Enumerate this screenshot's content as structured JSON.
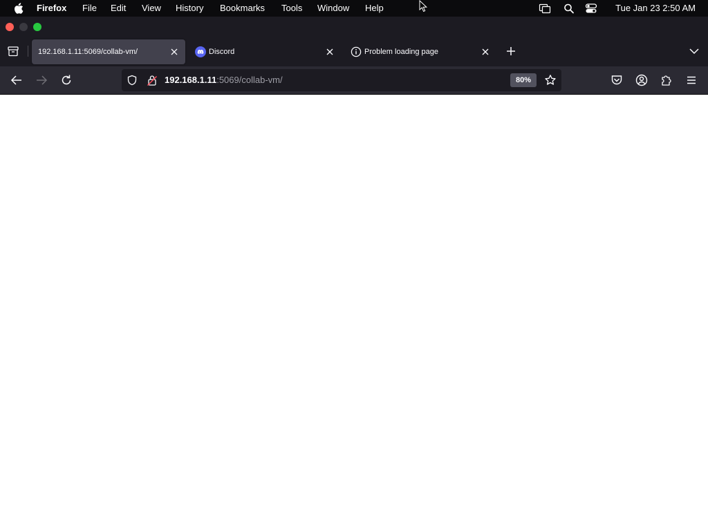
{
  "menubar": {
    "app_name": "Firefox",
    "items": [
      "File",
      "Edit",
      "View",
      "History",
      "Bookmarks",
      "Tools",
      "Window",
      "Help"
    ],
    "clock": "Tue Jan 23  2:50 AM"
  },
  "tabs": [
    {
      "title": "192.168.1.11:5069/collab-vm/",
      "active": true,
      "icon": "none"
    },
    {
      "title": "Discord",
      "active": false,
      "icon": "discord-icon"
    },
    {
      "title": "Problem loading page",
      "active": false,
      "icon": "info-icon"
    }
  ],
  "urlbar": {
    "host": "192.168.1.11",
    "rest": ":5069/collab-vm/",
    "zoom": "80%"
  },
  "colors": {
    "menubar_bg": "#0b0b0d",
    "tabstrip_bg": "#1c1b22",
    "active_tab_bg": "#42414d",
    "toolbar_bg": "#2b2a33",
    "urlbar_bg": "#1c1b22",
    "discord_blurple": "#5865f2",
    "close_red": "#ff5f57",
    "zoom_green": "#28c840"
  }
}
